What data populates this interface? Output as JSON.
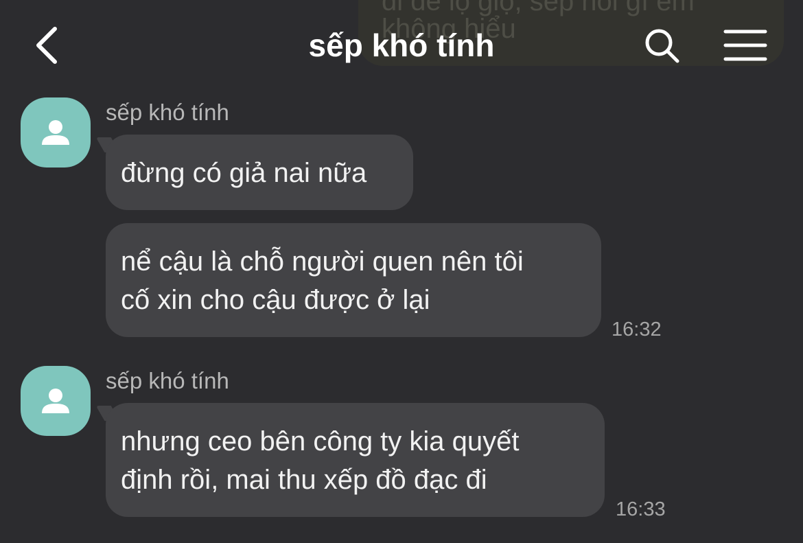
{
  "header": {
    "title": "sếp khó tính"
  },
  "previous_message": {
    "line_top": "đi để lộ giọ, sếp nói gì em",
    "line_bottom": "không hiểu"
  },
  "messages": [
    {
      "sender": "sếp khó tính",
      "bubbles": [
        {
          "lines": [
            "đừng có giả nai nữa"
          ]
        },
        {
          "lines": [
            "nể cậu là chỗ người quen nên tôi",
            "cố xin cho cậu được ở lại"
          ]
        }
      ],
      "time": "16:32"
    },
    {
      "sender": "sếp khó tính",
      "bubbles": [
        {
          "lines": [
            "nhưng ceo bên công ty kia quyết",
            "định rồi, mai thu xếp đồ đạc đi"
          ]
        }
      ],
      "time": "16:33"
    }
  ],
  "icons": {
    "back": "chevron-left-icon",
    "search": "search-icon",
    "menu": "hamburger-menu-icon",
    "avatar": "person-icon"
  },
  "colors": {
    "background": "#2c2c2f",
    "bubble": "#434346",
    "avatar": "#7fc6bd"
  }
}
